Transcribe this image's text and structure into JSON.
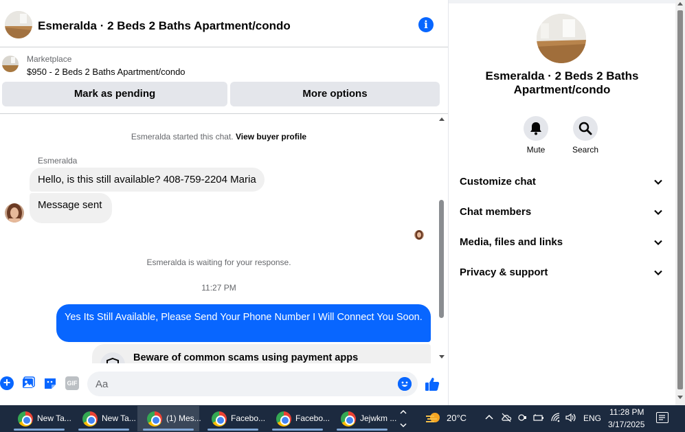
{
  "header": {
    "title": "Esmeralda · 2 Beds 2 Baths Apartment/condo"
  },
  "listing": {
    "source": "Marketplace",
    "title": "$950 - 2 Beds 2 Baths Apartment/condo",
    "mark_pending_label": "Mark as pending",
    "more_options_label": "More options"
  },
  "messages": {
    "started_text": "Esmeralda started this chat.",
    "view_profile_label": "View buyer profile",
    "sender_name": "Esmeralda",
    "incoming": [
      "Hello, is this still available? 408-759-2204 Maria",
      "Message sent"
    ],
    "waiting_text": "Esmeralda is waiting for your response.",
    "timestamp": "11:27 PM",
    "outgoing": "Yes Its Still Available, Please Send Your Phone Number I Will Connect You Soon.",
    "scam_warning": "Beware of common scams using payment apps"
  },
  "composer": {
    "placeholder": "Aa",
    "gif_label": "GIF"
  },
  "info_pane": {
    "title": "Esmeralda · 2 Beds 2 Baths Apartment/condo",
    "actions": [
      {
        "label": "Mute"
      },
      {
        "label": "Search"
      }
    ],
    "sections": [
      {
        "label": "Customize chat"
      },
      {
        "label": "Chat members"
      },
      {
        "label": "Media, files and links"
      },
      {
        "label": "Privacy & support"
      }
    ]
  },
  "taskbar": {
    "tasks": [
      {
        "label": "New Ta..."
      },
      {
        "label": "New Ta..."
      },
      {
        "label": "(1) Mes..."
      },
      {
        "label": "Facebo..."
      },
      {
        "label": "Facebo..."
      },
      {
        "label": "Jejwkm ..."
      }
    ],
    "temperature": "20°C",
    "language": "ENG",
    "time": "11:28 PM",
    "date": "3/17/2025"
  },
  "colors": {
    "accent": "#0866ff",
    "bubble_in": "#f0f0f0",
    "taskbar": "#1c2a3f"
  }
}
